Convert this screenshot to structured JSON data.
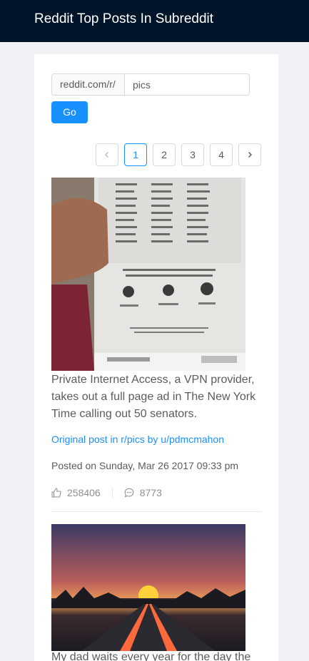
{
  "header": {
    "title": "Reddit Top Posts In Subreddit"
  },
  "search": {
    "prefix": "reddit.com/r/",
    "value": "pics",
    "go_label": "Go"
  },
  "pagination": {
    "pages": [
      "1",
      "2",
      "3",
      "4"
    ],
    "current": "1"
  },
  "posts": [
    {
      "title": "Private Internet Access, a VPN provider, takes out a full page ad in The New York Time calling out 50 senators.",
      "link": "Original post in r/pics by u/pdmcmahon",
      "posted": "Posted on Sunday, Mar 26 2017 09:33 pm",
      "upvotes": "258406",
      "comments": "8773"
    },
    {
      "title": "My dad waits every year for the day the"
    }
  ],
  "colors": {
    "header": "#001529",
    "primary": "#1890ff"
  }
}
